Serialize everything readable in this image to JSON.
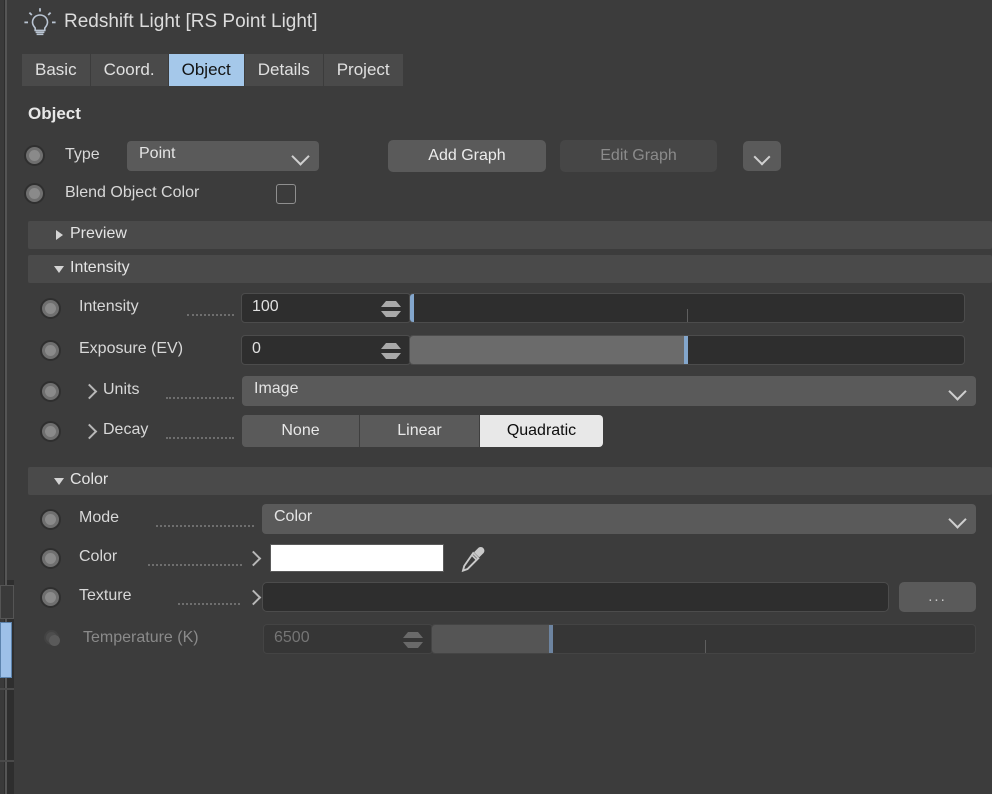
{
  "window": {
    "icon": "light-bulb-icon",
    "title": "Redshift Light [RS Point Light]"
  },
  "tabs": [
    {
      "label": "Basic",
      "active": false
    },
    {
      "label": "Coord.",
      "active": false
    },
    {
      "label": "Object",
      "active": true
    },
    {
      "label": "Details",
      "active": false
    },
    {
      "label": "Project",
      "active": false
    }
  ],
  "object_group": {
    "heading": "Object",
    "type": {
      "label": "Type",
      "value": "Point"
    },
    "add_graph_label": "Add Graph",
    "edit_graph_label": "Edit Graph",
    "blend_object_color": {
      "label": "Blend Object Color",
      "checked": false
    }
  },
  "sections": {
    "preview": {
      "label": "Preview",
      "expanded": false
    },
    "intensity": {
      "label": "Intensity",
      "expanded": true
    },
    "color": {
      "label": "Color",
      "expanded": true
    }
  },
  "intensity_group": {
    "intensity": {
      "label": "Intensity",
      "value": "100",
      "slider": {
        "fill_pct": 0,
        "handle_pct": 0,
        "tick_pct": 50
      }
    },
    "exposure": {
      "label": "Exposure (EV)",
      "value": "0",
      "slider": {
        "fill_pct": 50,
        "handle_pct": 50,
        "tick_pct": -1
      }
    },
    "units": {
      "label": "Units",
      "value": "Image"
    },
    "decay": {
      "label": "Decay",
      "options": [
        "None",
        "Linear",
        "Quadratic"
      ],
      "selected": "Quadratic"
    }
  },
  "color_group": {
    "mode": {
      "label": "Mode",
      "value": "Color"
    },
    "color": {
      "label": "Color",
      "swatch_hex": "#ffffff",
      "picker_icon": "eyedropper-icon"
    },
    "texture": {
      "label": "Texture",
      "value": "",
      "browse_label": "..."
    },
    "temperature": {
      "label": "Temperature (K)",
      "value": "6500",
      "disabled": true,
      "slider": {
        "fill_pct": 21,
        "handle_pct": 21,
        "tick_pct": 50
      }
    }
  },
  "theme": {
    "panel_bg": "#3c3c3c",
    "section_bg": "#4a4a4a",
    "control_bg": "#5a5a5a",
    "field_bg": "#2e2e2e",
    "accent_tab": "#a5c8ea",
    "accent_slider": "#83a6cc",
    "text": "#d8d8d8",
    "text_disabled": "#8a8a8a"
  }
}
